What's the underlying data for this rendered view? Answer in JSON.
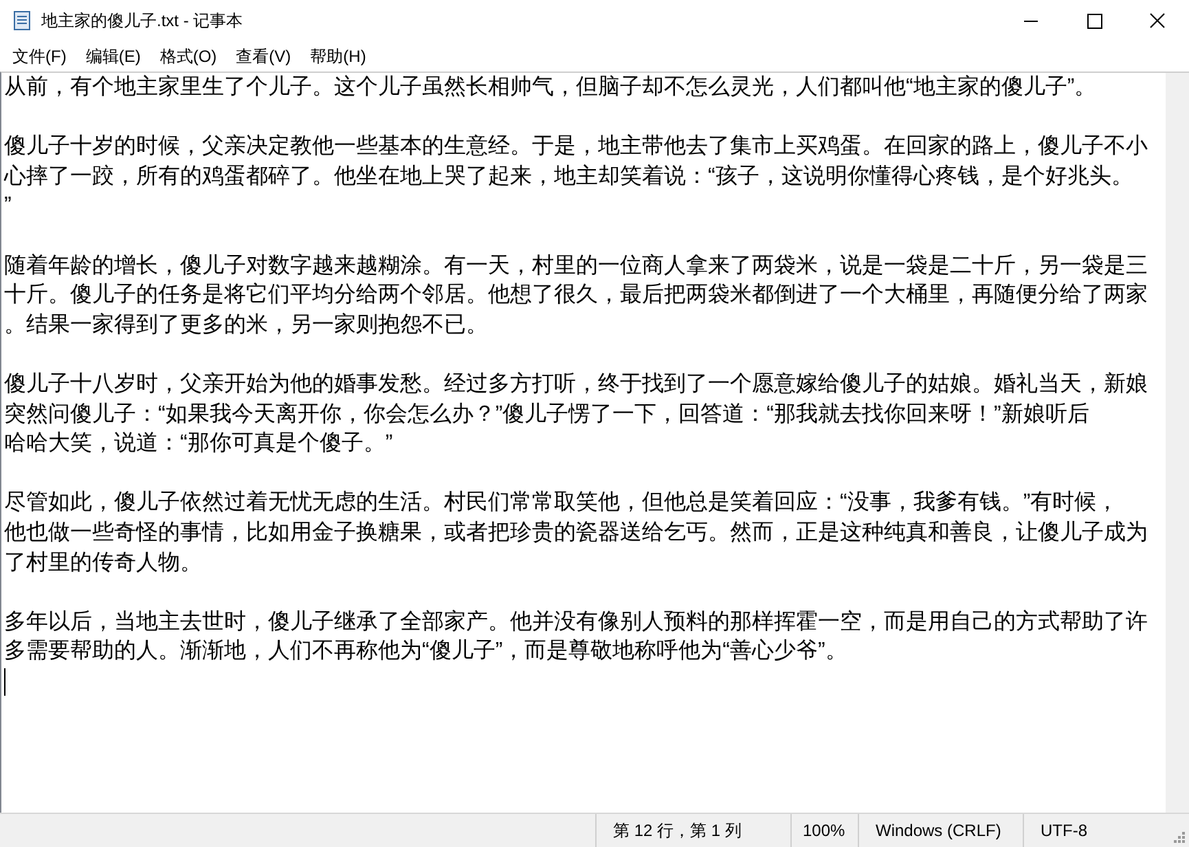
{
  "window": {
    "title": "地主家的傻儿子.txt - 记事本"
  },
  "menu": [
    "文件(F)",
    "编辑(E)",
    "格式(O)",
    "查看(V)",
    "帮助(H)"
  ],
  "document": {
    "paragraphs": [
      {
        "lines": [
          "从前，有个地主家里生了个儿子。这个儿子虽然长相帅气，但脑子却不怎么灵光，人们都叫他“地主家的傻儿子”。"
        ]
      },
      {
        "lines": [
          "傻儿子十岁的时候，父亲决定教他一些基本的生意经。于是，地主带他去了集市上买鸡蛋。在回家的路上，傻儿子不小",
          "心摔了一跤，所有的鸡蛋都碎了。他坐在地上哭了起来，地主却笑着说：“孩子，这说明你懂得心疼钱，是个好兆头。",
          "”"
        ]
      },
      {
        "lines": [
          "随着年龄的增长，傻儿子对数字越来越糊涂。有一天，村里的一位商人拿来了两袋米，说是一袋是二十斤，另一袋是三",
          "十斤。傻儿子的任务是将它们平均分给两个邻居。他想了很久，最后把两袋米都倒进了一个大桶里，再随便分给了两家",
          "。结果一家得到了更多的米，另一家则抱怨不已。"
        ]
      },
      {
        "lines": [
          "傻儿子十八岁时，父亲开始为他的婚事发愁。经过多方打听，终于找到了一个愿意嫁给傻儿子的姑娘。婚礼当天，新娘",
          "突然问傻儿子：“如果我今天离开你，你会怎么办？”傻儿子愣了一下，回答道：“那我就去找你回来呀！”新娘听后",
          "哈哈大笑，说道：“那你可真是个傻子。”"
        ]
      },
      {
        "lines": [
          "尽管如此，傻儿子依然过着无忧无虑的生活。村民们常常取笑他，但他总是笑着回应：“没事，我爹有钱。”有时候，",
          "他也做一些奇怪的事情，比如用金子换糖果，或者把珍贵的瓷器送给乞丐。然而，正是这种纯真和善良，让傻儿子成为",
          "了村里的传奇人物。"
        ]
      },
      {
        "lines": [
          "多年以后，当地主去世时，傻儿子继承了全部家产。他并没有像别人预料的那样挥霍一空，而是用自己的方式帮助了许",
          "多需要帮助的人。渐渐地，人们不再称他为“傻儿子”，而是尊敬地称呼他为“善心少爷”。"
        ]
      }
    ]
  },
  "status_bar": [
    "第 12 行，第 1 列",
    "100%",
    "Windows (CRLF)",
    "UTF-8"
  ]
}
